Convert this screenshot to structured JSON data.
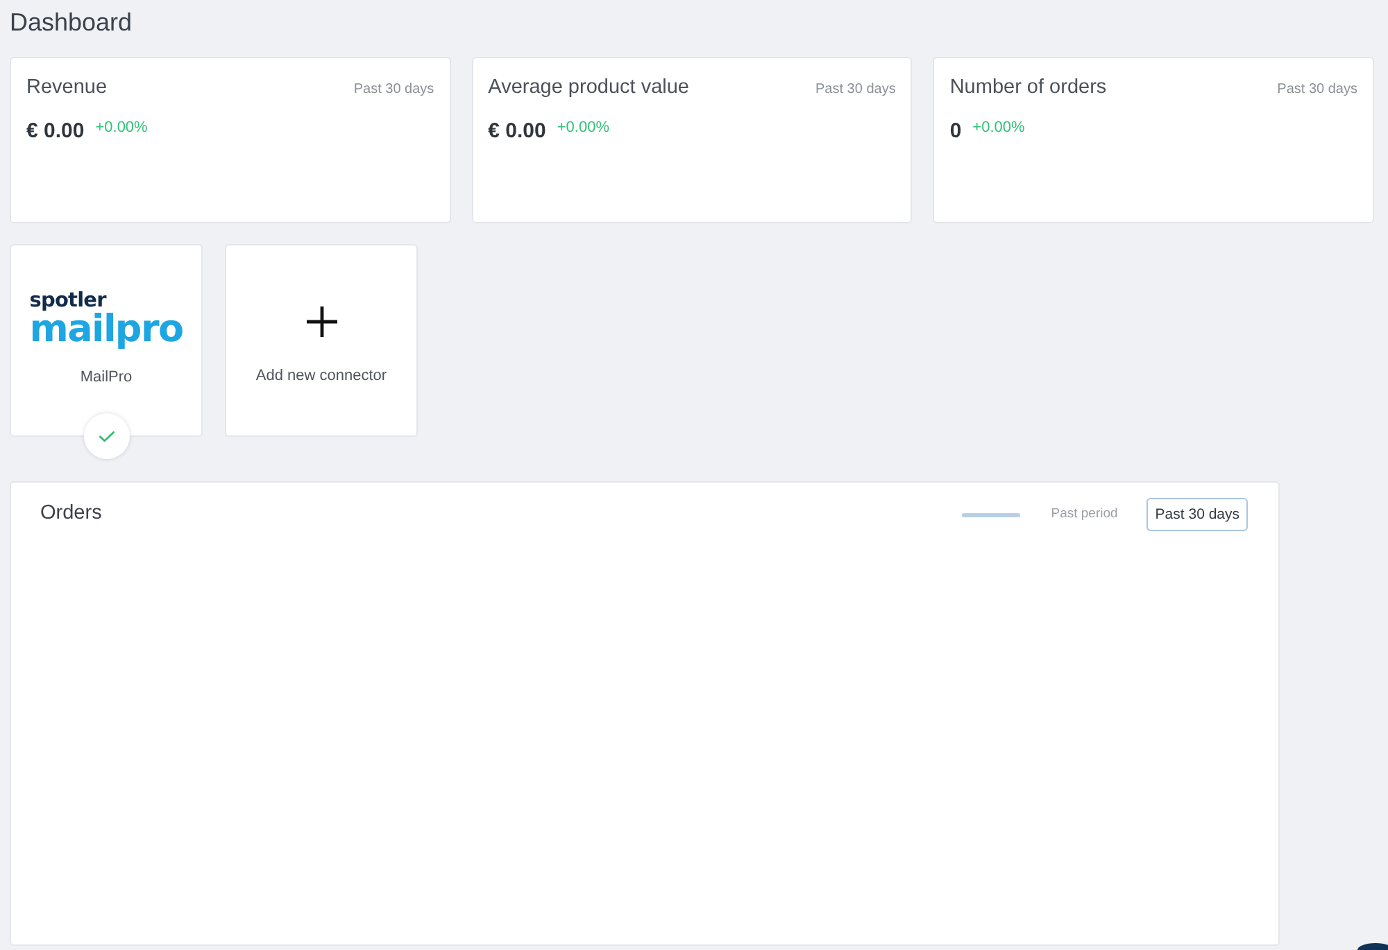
{
  "page": {
    "title": "Dashboard"
  },
  "metrics": [
    {
      "title": "Revenue",
      "period": "Past 30 days",
      "value": "€ 0.00",
      "change": "+0.00%"
    },
    {
      "title": "Average product value",
      "period": "Past 30 days",
      "value": "€ 0.00",
      "change": "+0.00%"
    },
    {
      "title": "Number of orders",
      "period": "Past 30 days",
      "value": "0",
      "change": "+0.00%"
    }
  ],
  "connectors": [
    {
      "kind": "integration",
      "logo": {
        "top": "spotler",
        "bottom": "mailpro"
      },
      "label": "MailPro",
      "connected": true
    },
    {
      "kind": "add",
      "label": "Add new connector"
    }
  ],
  "orders": {
    "title": "Orders",
    "legend": [
      {
        "label": "Past period"
      }
    ],
    "period_button": "Past 30 days"
  }
}
